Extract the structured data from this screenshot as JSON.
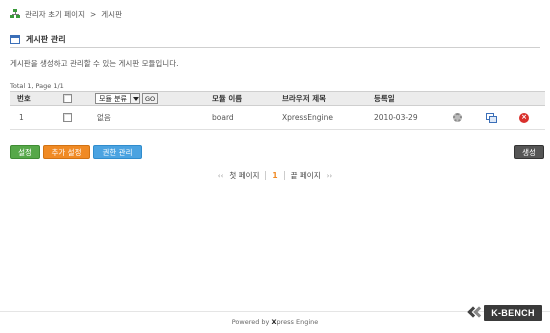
{
  "breadcrumb": {
    "items": [
      "관리자 초기 페이지",
      "게시판"
    ],
    "separator": ">"
  },
  "section": {
    "title": "게시판 관리",
    "description": "게시판을 생성하고 관리할 수 있는 게시판 모듈입니다."
  },
  "table": {
    "total": "Total 1, Page 1/1",
    "headers": {
      "no": "번호",
      "category_select": "모듈 분류",
      "go": "GO",
      "module_name": "모듈 이름",
      "browser_title": "브라우저 제목",
      "regdate": "등록일"
    },
    "rows": [
      {
        "no": "1",
        "category": "없음",
        "module_name": "board",
        "browser_title": "XpressEngine",
        "regdate": "2010-03-29",
        "delete_glyph": "×"
      }
    ]
  },
  "buttons": {
    "settings": "설정",
    "additional_settings": "추가 설정",
    "permissions": "권한 관리",
    "create": "생성"
  },
  "pagination": {
    "first": "첫 페이지",
    "current": "1",
    "last": "끝 페이지",
    "prev_arrow": "‹‹",
    "next_arrow": "››"
  },
  "footer": {
    "prefix": "Powered by",
    "brand_x": "X",
    "brand_rest": "press Engine"
  },
  "watermark": {
    "text": "K-BENCH"
  },
  "icons": {
    "breadcrumb": "sitemap-icon",
    "section": "window-icon",
    "row_settings": "gear-icon",
    "row_copy": "copy-icon",
    "row_delete": "delete-icon"
  },
  "colors": {
    "settings_btn": "#56a849",
    "additional_btn": "#f08a24",
    "permissions_btn": "#4ba3e1",
    "create_btn": "#555555",
    "current_page": "#f08a24",
    "delete_icon": "#d9302c"
  }
}
